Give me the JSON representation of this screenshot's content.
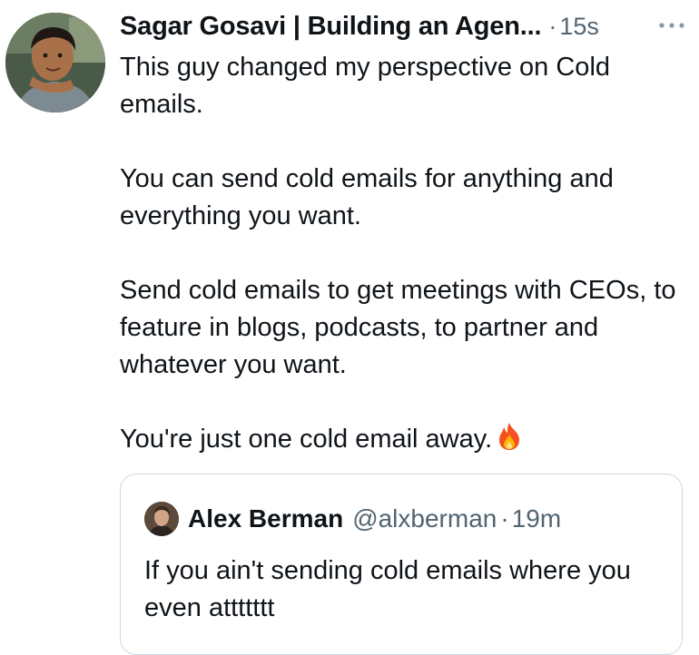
{
  "tweet": {
    "author_name": "Sagar Gosavi | Building an Agen...",
    "separator": "·",
    "time": "15s",
    "more_icon": "more-horizontal-icon",
    "paragraphs": [
      "This guy changed my perspective on Cold emails.",
      "You can send cold emails for anything and everything you want.",
      "Send cold emails to get meetings with CEOs, to feature in blogs, podcasts, to partner and whatever you want.",
      "You're just one cold email away."
    ],
    "emoji": "fire-emoji"
  },
  "quoted_tweet": {
    "author_name": "Alex Berman",
    "handle": "@alxberman",
    "separator": "·",
    "time": "19m",
    "text": "If you ain't sending cold emails where you even attttttt"
  },
  "colors": {
    "text_primary": "#0f1419",
    "text_secondary": "#536471",
    "border": "#cfd9de"
  }
}
